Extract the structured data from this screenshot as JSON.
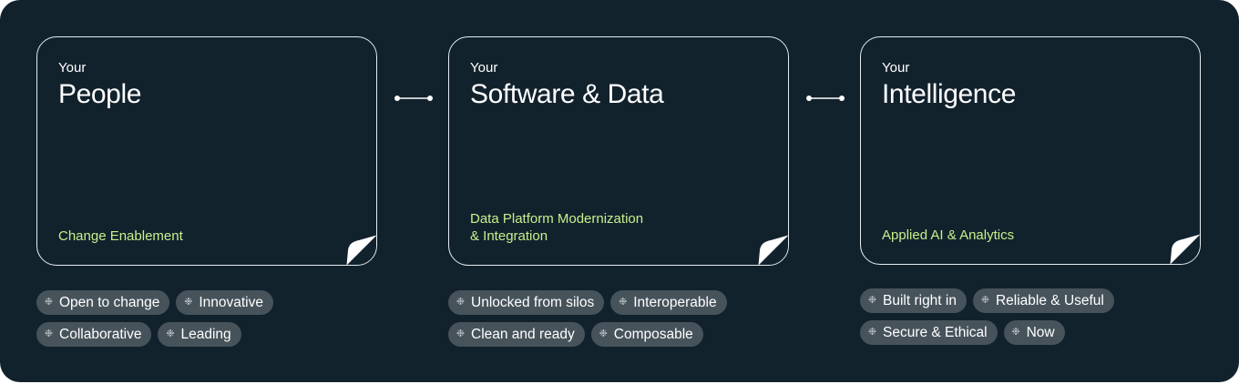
{
  "colors": {
    "background": "#12222d",
    "card_border": "#e6ecef",
    "accent_green": "#c8f08c",
    "chip_background": "#46535b"
  },
  "icons": {
    "chip": "sparkle-icon",
    "connector": "connector-line-icon",
    "corner": "page-fold-icon"
  },
  "spark_glyph": "❉",
  "cards": [
    {
      "kicker": "Your",
      "title": "People",
      "subtitle": "Change Enablement",
      "chips": [
        [
          "Open to change",
          "Innovative"
        ],
        [
          "Collaborative",
          "Leading"
        ]
      ]
    },
    {
      "kicker": "Your",
      "title": "Software & Data",
      "subtitle": "Data Platform Modernization\n& Integration",
      "chips": [
        [
          "Unlocked from silos",
          "Interoperable"
        ],
        [
          "Clean and ready",
          "Composable"
        ]
      ]
    },
    {
      "kicker": "Your",
      "title": "Intelligence",
      "subtitle": "Applied AI & Analytics",
      "chips": [
        [
          "Built right in",
          "Reliable & Useful"
        ],
        [
          "Secure & Ethical",
          "Now"
        ]
      ]
    }
  ]
}
